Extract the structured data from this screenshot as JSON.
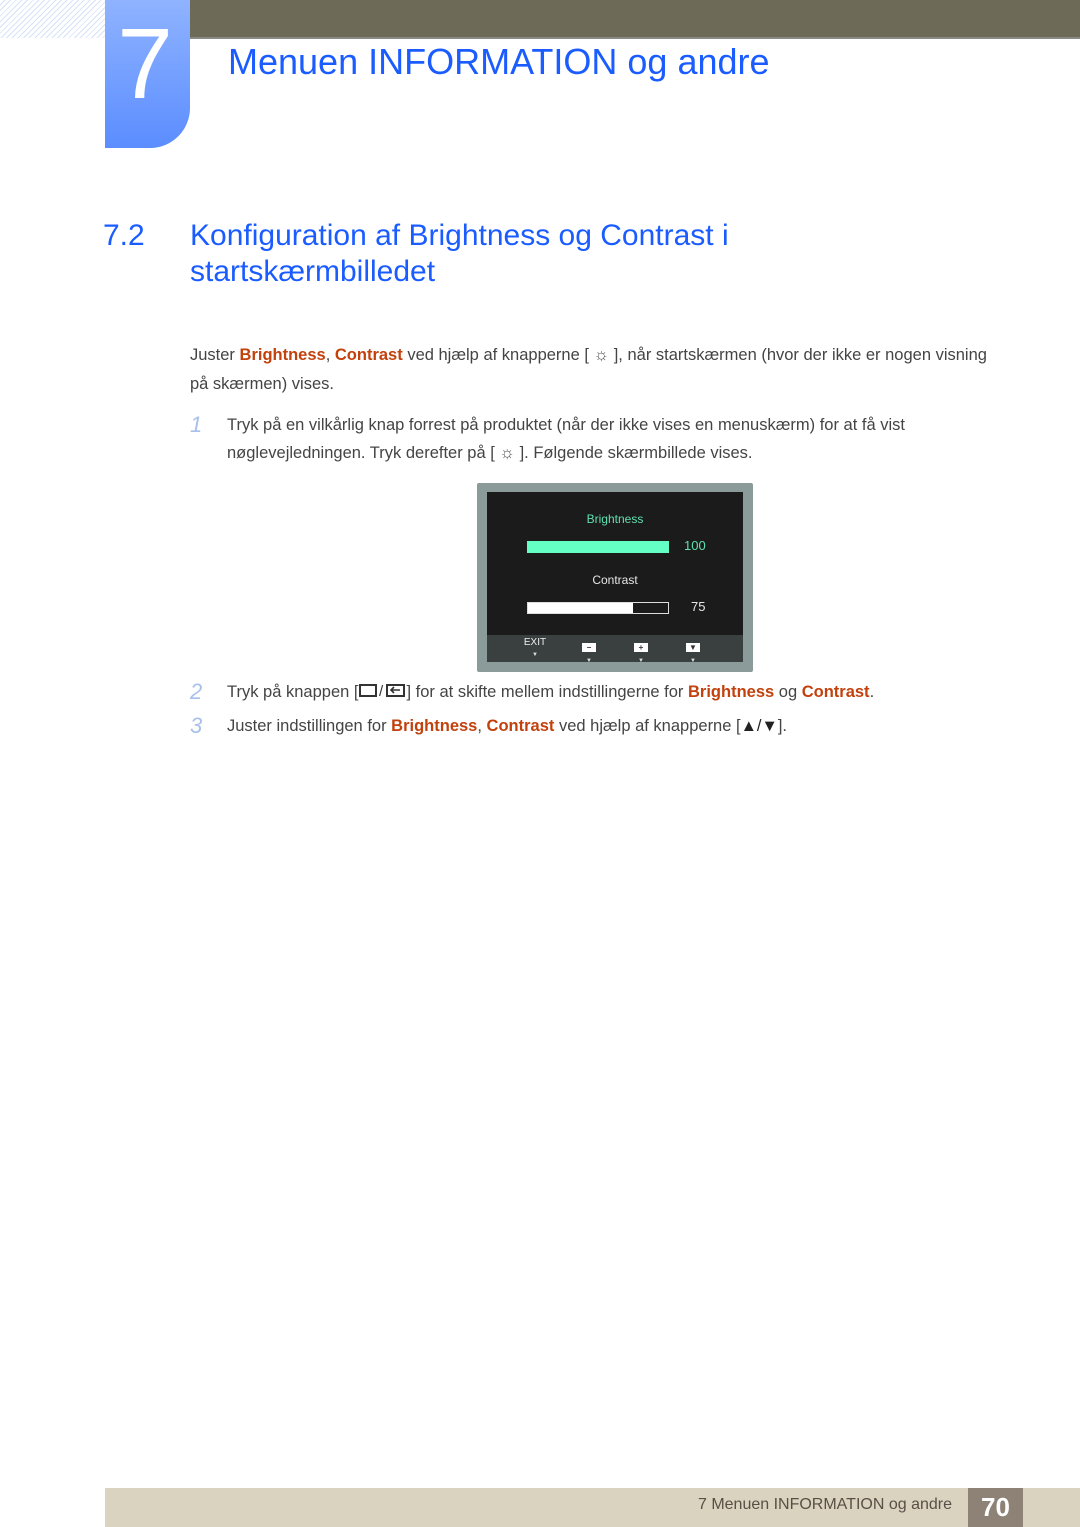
{
  "chapter": {
    "number": "7",
    "title": "Menuen INFORMATION og andre"
  },
  "section": {
    "number": "7.2",
    "title": "Konfiguration af Brightness og Contrast i startskærmbilledet"
  },
  "intro": {
    "part1": "Juster ",
    "hl1": "Brightness",
    "sep": ", ",
    "hl2": "Contrast",
    "part2": " ved hjælp af knapperne [ ",
    "icon": "sun-icon",
    "part3": " ], når startskærmen (hvor der ikke er nogen visning på skærmen) vises."
  },
  "steps": [
    {
      "number": "1",
      "part1": "Tryk på en vilkårlig knap forrest på produktet (når der ikke vises en menuskærm) for at få vist nøglevejledningen. Tryk derefter på [ ",
      "icon": "sun-icon",
      "part2": " ]. Følgende skærmbillede vises."
    },
    {
      "number": "2",
      "part1": "Tryk på knappen [",
      "icon": "source-enter-icon",
      "part2": "] for at skifte mellem indstillingerne for ",
      "hl1": "Brightness",
      "part3": " og ",
      "hl2": "Contrast",
      "part4": "."
    },
    {
      "number": "3",
      "part1": "Juster indstillingen for ",
      "hl1": "Brightness",
      "sep": ", ",
      "hl2": "Contrast",
      "part2": " ved hjælp af knapperne [",
      "arrows": "▲/▼",
      "part3": "]."
    }
  ],
  "osd": {
    "brightness_label": "Brightness",
    "brightness_value": "100",
    "brightness_fraction": 1.0,
    "contrast_label": "Contrast",
    "contrast_value": "75",
    "contrast_fraction": 0.75,
    "buttons": [
      {
        "label": "EXIT",
        "key": ""
      },
      {
        "label": "",
        "key": "−"
      },
      {
        "label": "",
        "key": "+"
      },
      {
        "label": "",
        "key": "▼"
      }
    ],
    "colors": {
      "accent": "#63ffc4",
      "background": "#1c1b1b"
    }
  },
  "footer": {
    "text": "7 Menuen INFORMATION og andre",
    "page": "70"
  },
  "colors": {
    "heading": "#1a5cff",
    "highlight": "#c2410c",
    "topbar": "#6d6b58",
    "footer": "#dad3bf"
  }
}
